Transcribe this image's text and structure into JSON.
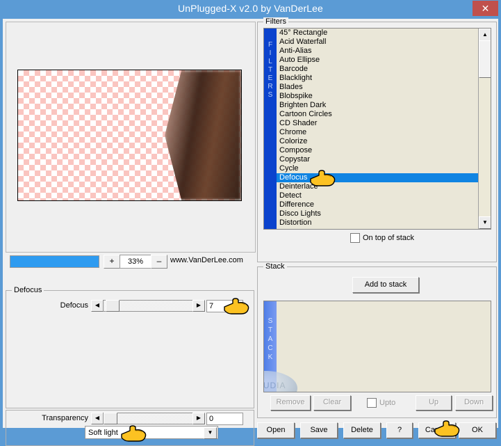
{
  "window": {
    "title": "UnPlugged-X v2.0 by VanDerLee",
    "close_label": "✕",
    "accent_title_bar": "#5b9bd5",
    "accent_close_button": "#c0504d"
  },
  "preview": {
    "panel_name": "preview",
    "checker_color": "#fac5c0",
    "shape": "left-pointing-gradient-arrow"
  },
  "zoom": {
    "plus_label": "+",
    "minus_label": "–",
    "value": "33%",
    "bar_fill_color": "#2e9bf0",
    "url": "www.VanDerLee.com"
  },
  "defocus_group": {
    "label": "Defocus",
    "slider_label": "Defocus",
    "left_arrow": "◀",
    "right_arrow": "▶",
    "value": "7"
  },
  "transparency_group": {
    "slider_label": "Transparency",
    "left_arrow": "◀",
    "right_arrow": "▶",
    "value": "0",
    "blend_mode": "Soft light",
    "combo_arrow": "▼"
  },
  "filters_group": {
    "label": "Filters",
    "sidebar_text": "FILTERS",
    "selected": "Defocus",
    "items": [
      "45° Rectangle",
      "Acid Waterfall",
      "Anti-Alias",
      "Auto Ellipse",
      "Barcode",
      "Blacklight",
      "Blades",
      "Blobspike",
      "Brighten Dark",
      "Cartoon Circles",
      "CD Shader",
      "Chrome",
      "Colorize",
      "Compose",
      "Copystar",
      "Cycle",
      "Defocus",
      "Deinterlace",
      "Detect",
      "Difference",
      "Disco Lights",
      "Distortion"
    ],
    "scroll_up": "▲",
    "scroll_down": "▼",
    "on_top_label": "On top of stack",
    "on_top_checked": false
  },
  "stack_group": {
    "label": "Stack",
    "sidebar_text": "STACK",
    "add_button": "Add to stack",
    "items": [],
    "remove_button": "Remove",
    "clear_button": "Clear",
    "upto_label": "Upto",
    "upto_checked": false,
    "up_button": "Up",
    "down_button": "Down"
  },
  "bottom_buttons": {
    "open": "Open",
    "save": "Save",
    "delete": "Delete",
    "help": "?",
    "cancel": "Cancel",
    "ok": "OK"
  },
  "watermark": {
    "text": "CLAUDIA"
  }
}
